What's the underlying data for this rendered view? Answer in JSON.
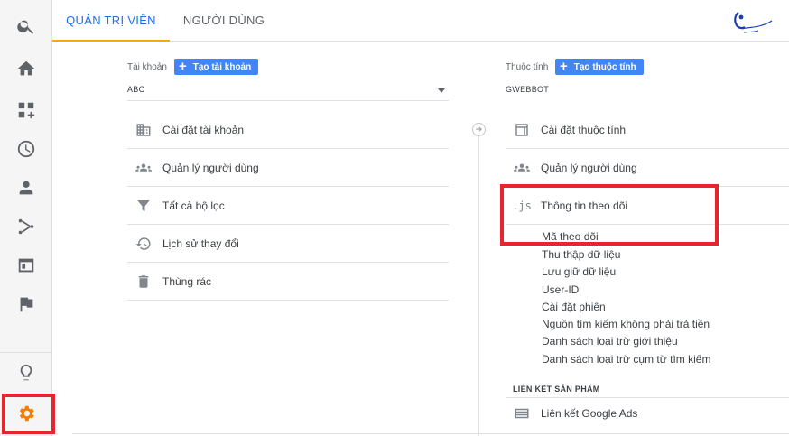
{
  "tabs": {
    "admin": "QUẢN TRỊ VIÊN",
    "users": "NGƯỜI DÙNG"
  },
  "rail": {
    "icons": [
      "search-icon",
      "home-icon",
      "customization-icon",
      "realtime-icon",
      "audience-icon",
      "acquisition-icon",
      "behavior-icon",
      "conversions-icon",
      "discover-icon",
      "admin-gear-icon"
    ]
  },
  "account": {
    "label": "Tài khoản",
    "create_button": "Tạo tài khoản",
    "selected": "ABC",
    "items": [
      {
        "label": "Cài đặt tài khoản",
        "icon": "building-icon"
      },
      {
        "label": "Quản lý người dùng",
        "icon": "people-icon"
      },
      {
        "label": "Tất cả bộ lọc",
        "icon": "filter-icon"
      },
      {
        "label": "Lịch sử thay đổi",
        "icon": "history-icon"
      },
      {
        "label": "Thùng rác",
        "icon": "trash-icon"
      }
    ]
  },
  "property": {
    "label": "Thuộc tính",
    "create_button": "Tạo thuộc tính",
    "selected": "GWEBBOT",
    "items": [
      {
        "label": "Cài đặt thuộc tính",
        "icon": "window-icon"
      },
      {
        "label": "Quản lý người dùng",
        "icon": "people-icon"
      },
      {
        "label": "Thông tin theo dõi",
        "icon": "js-icon",
        "icon_text": ".js"
      }
    ],
    "tracking_sub_items": [
      "Mã theo dõi",
      "Thu thập dữ liệu",
      "Lưu giữ dữ liệu",
      "User-ID",
      "Cài đặt phiên",
      "Nguồn tìm kiếm không phải trả tiền",
      "Danh sách loại trừ giới thiệu",
      "Danh sách loại trừ cụm từ tìm kiếm"
    ],
    "product_links": {
      "title": "LIÊN KẾT SẢN PHẨM",
      "items": [
        {
          "label": "Liên kết Google Ads",
          "icon": "ads-icon"
        }
      ]
    }
  },
  "colors": {
    "accent": "#1a73e8",
    "tab_underline": "#f9ab00",
    "highlight": "#e8252f",
    "settings_icon": "#f57c00",
    "button": "#4285f4"
  }
}
